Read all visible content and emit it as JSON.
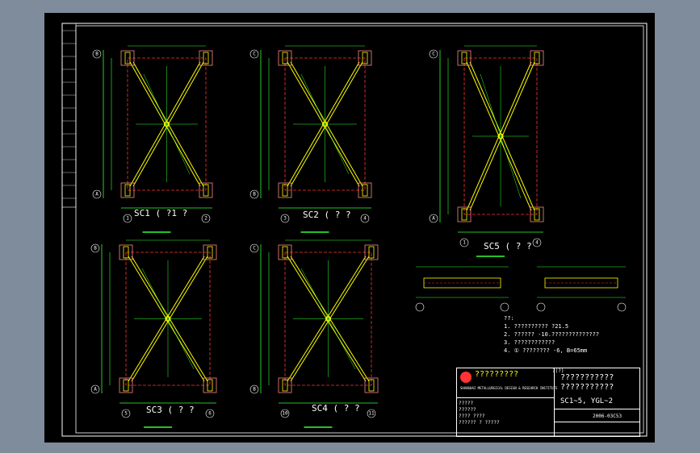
{
  "window": {
    "background": "#7f8c9b",
    "canvas_background": "#000000"
  },
  "colors": {
    "border": "#ffffff",
    "dimension": "#33ff33",
    "brace": "#ffff00",
    "centerline": "#ff3333",
    "anchor": "#ff8888"
  },
  "drawings": [
    {
      "id": "sc1",
      "title": "SC1 ( ?1  ?",
      "grid_left": "1",
      "grid_right": "2",
      "grid_bottom": "A",
      "grid_top": "B"
    },
    {
      "id": "sc2",
      "title": "SC2 ( ? ?",
      "grid_left": "3",
      "grid_right": "4",
      "grid_bottom": "B",
      "grid_top": "C"
    },
    {
      "id": "sc3",
      "title": "SC3 ( ? ?",
      "grid_left": "5",
      "grid_right": "6",
      "grid_bottom": "A",
      "grid_top": "B"
    },
    {
      "id": "sc4",
      "title": "SC4 ( ? ?",
      "grid_left": "10",
      "grid_right": "11",
      "grid_bottom": "B",
      "grid_top": "C"
    },
    {
      "id": "sc5",
      "title": "SC5 ( ? ?",
      "grid_left": "1",
      "grid_right": "4",
      "grid_bottom": "A",
      "grid_top": "C"
    }
  ],
  "notes": {
    "heading": "??:",
    "items": [
      "1. ??????????  ?21.5",
      "2. ??????  -10.??????????????",
      "3. ????????????",
      "4. ① ????????  -6, B=65mm"
    ]
  },
  "title_block": {
    "company": "?????????",
    "company_en": "SHANGHAI METALLURGICAL DESIGN & RESEARCH INSTITUTE",
    "project_label": "?(?)",
    "drawing_title": "???????????",
    "drawing_title_line2": "???????????",
    "drawing_number": "SC1~5, YGL~2",
    "row_labels": [
      "?????",
      "??????",
      "???? ????",
      "?????? ? ?????"
    ],
    "code": "2006-03C53"
  }
}
